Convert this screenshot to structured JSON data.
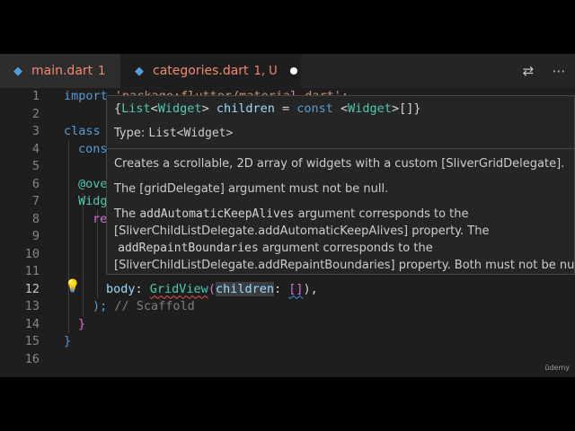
{
  "tabs": [
    {
      "icon": "dart-icon",
      "name": "main.dart",
      "status": "1"
    },
    {
      "icon": "dart-icon",
      "name": "categories.dart",
      "status": "1, U"
    }
  ],
  "line_numbers": [
    "1",
    "2",
    "3",
    "4",
    "5",
    "6",
    "7",
    "8",
    "9",
    "10",
    "11",
    "12",
    "13",
    "14",
    "15",
    "16"
  ],
  "code": {
    "l1_import": "import",
    "l1_rest": " 'package:flutter/material.dart';",
    "l3_class": "class",
    "l4_const": "cons",
    "l6_ann": "@ove",
    "l7_widget": "Widg",
    "l8_re": "re",
    "l12_body": "body",
    "l12_colon": ": ",
    "l12_grid": "GridView",
    "l12_paren": "(",
    "l12_children": "children",
    "l12_colon2": ": ",
    "l12_list": "[]",
    "l12_end": "),",
    "l13_paren": ");",
    "l13_comment": " // Scaffold",
    "l14_brace": "}",
    "l15_brace": "}"
  },
  "hover": {
    "signature_open": "{",
    "sig_type": "List",
    "sig_lt": "<",
    "sig_widget": "Widget",
    "sig_gt": "> ",
    "sig_name": "children",
    "sig_eq": " = ",
    "sig_const": "const",
    "sig_lt2": " <",
    "sig_widget2": "Widget",
    "sig_rest": ">[]}",
    "type_label": "Type: ",
    "type_value": "List<Widget>",
    "p1": "Creates a scrollable, 2D array of widgets with a custom [SliverGridDelegate].",
    "p2": "The [gridDelegate] argument must not be null.",
    "p3_a": "The ",
    "p3_code": "addAutomaticKeepAlives",
    "p3_b": " argument corresponds to the",
    "p3_l2": "[SliverChildListDelegate.addAutomaticKeepAlives] property. The",
    "p3_code2": "addRepaintBoundaries",
    "p3_c": " argument corresponds to the",
    "p3_l4": "[SliverChildListDelegate.addRepaintBoundaries] property. Both must not be null."
  },
  "watermark": "ūdemy"
}
